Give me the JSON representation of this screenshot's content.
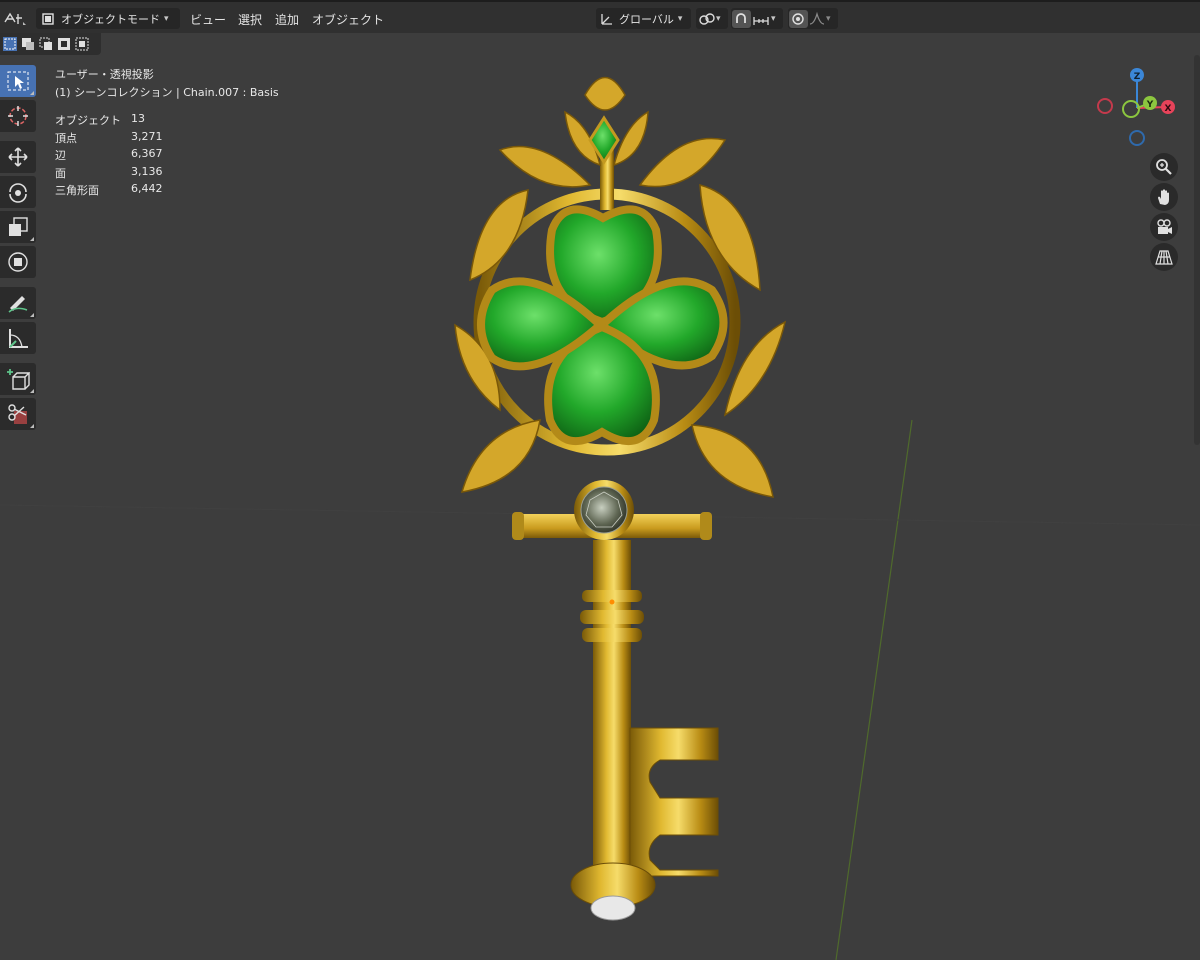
{
  "header": {
    "mode_label": "オブジェクトモード",
    "menus": [
      "ビュー",
      "選択",
      "追加",
      "オブジェクト"
    ],
    "transform_orientation": "グローバル"
  },
  "overlay": {
    "view_name": "ユーザー・透視投影",
    "collection_info": "(1) シーンコレクション | Chain.007 : Basis",
    "stats": [
      {
        "label": "オブジェクト",
        "value": "13"
      },
      {
        "label": "頂点",
        "value": "3,271"
      },
      {
        "label": "辺",
        "value": "6,367"
      },
      {
        "label": "面",
        "value": "3,136"
      },
      {
        "label": "三角形面",
        "value": "6,442"
      }
    ]
  },
  "gizmo": {
    "z": "Z",
    "y": "Y",
    "x": "X"
  },
  "colors": {
    "accent": "#4772b3",
    "header_bg": "#303030",
    "viewport_bg": "#3d3d3d",
    "x_axis": "#e8435a",
    "y_axis": "#8cc63f",
    "z_axis": "#3b87d8"
  },
  "toolbar_tools": [
    "select-box",
    "cursor",
    "move",
    "rotate",
    "scale",
    "transform",
    "annotate",
    "measure",
    "add-cube",
    "transform-cut"
  ],
  "nav_buttons": [
    "zoom-icon",
    "pan-hand-icon",
    "camera-view-icon",
    "perspective-grid-icon"
  ]
}
